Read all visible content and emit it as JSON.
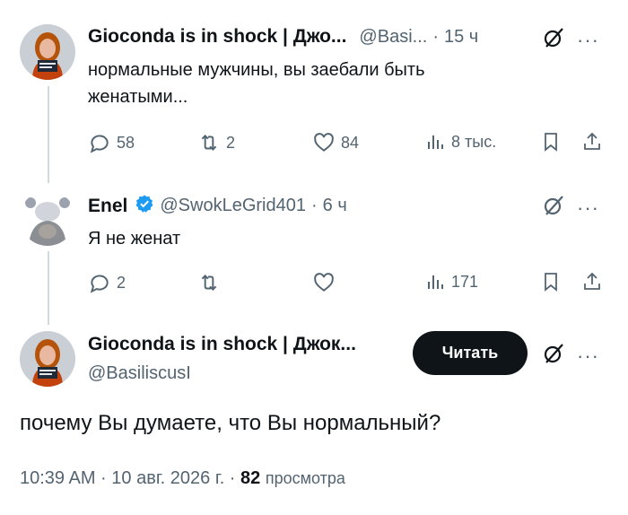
{
  "tweet1": {
    "author_name": "Gioconda is in shock | Джо...",
    "handle": "@Basi...",
    "separator": "·",
    "time": "15 ч",
    "more_label": "···",
    "text": "нормальные мужчины, вы заебали быть женатыми...",
    "replies": "58",
    "reposts": "2",
    "likes": "84",
    "views": "8 тыс."
  },
  "tweet2": {
    "author_name": "Enel",
    "verified": true,
    "handle": "@SwokLeGrid401",
    "separator": "·",
    "time": "6 ч",
    "more_label": "···",
    "text": "Я не женат",
    "replies": "2",
    "reposts": "",
    "likes": "",
    "views": "171"
  },
  "main_tweet": {
    "author_name": "Gioconda is in shock | Джок...",
    "handle": "@BasiliscusI",
    "follow_label": "Читать",
    "more_label": "···",
    "text": "почему Вы думаете, что Вы нормальный?",
    "timestamp": "10:39 AM · 10 авг. 2026 г. ·",
    "views_count": "82",
    "views_label": "просмотра"
  },
  "colors": {
    "text_primary": "#0f1419",
    "text_secondary": "#536471",
    "verified": "#1d9bf0",
    "thread_line": "#cfd9de",
    "button_bg": "#0f1419"
  },
  "icons": [
    "reply-icon",
    "repost-icon",
    "like-icon",
    "views-icon",
    "bookmark-icon",
    "share-icon",
    "grok-icon",
    "verified-badge-icon",
    "more-icon"
  ]
}
